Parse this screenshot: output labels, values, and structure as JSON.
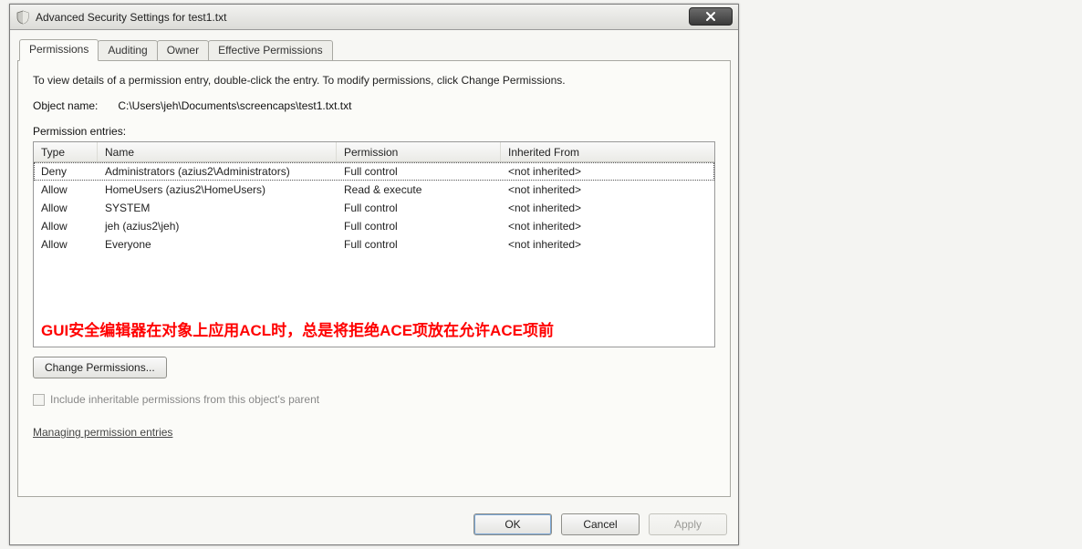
{
  "window": {
    "title": "Advanced Security Settings for test1.txt"
  },
  "tabs": [
    {
      "label": "Permissions",
      "active": true
    },
    {
      "label": "Auditing",
      "active": false
    },
    {
      "label": "Owner",
      "active": false
    },
    {
      "label": "Effective Permissions",
      "active": false
    }
  ],
  "panel": {
    "instruction": "To view details of a permission entry, double-click the entry. To modify permissions, click Change Permissions.",
    "object_name_label": "Object name:",
    "object_name_value": "C:\\Users\\jeh\\Documents\\screencaps\\test1.txt.txt",
    "entries_label": "Permission entries:",
    "columns": {
      "type": "Type",
      "name": "Name",
      "permission": "Permission",
      "inherited": "Inherited From"
    },
    "rows": [
      {
        "type": "Deny",
        "name": "Administrators (azius2\\Administrators)",
        "permission": "Full control",
        "inherited": "<not inherited>",
        "focused": true
      },
      {
        "type": "Allow",
        "name": "HomeUsers (azius2\\HomeUsers)",
        "permission": "Read & execute",
        "inherited": "<not inherited>"
      },
      {
        "type": "Allow",
        "name": "SYSTEM",
        "permission": "Full control",
        "inherited": "<not inherited>"
      },
      {
        "type": "Allow",
        "name": "jeh (azius2\\jeh)",
        "permission": "Full control",
        "inherited": "<not inherited>"
      },
      {
        "type": "Allow",
        "name": "Everyone",
        "permission": "Full control",
        "inherited": "<not inherited>"
      }
    ],
    "annotation": "GUI安全编辑器在对象上应用ACL时，总是将拒绝ACE项放在允许ACE项前",
    "change_button": "Change Permissions...",
    "include_inheritable_label": "Include inheritable permissions from this object's parent",
    "link_text": "Managing permission entries"
  },
  "footer": {
    "ok": "OK",
    "cancel": "Cancel",
    "apply": "Apply"
  }
}
